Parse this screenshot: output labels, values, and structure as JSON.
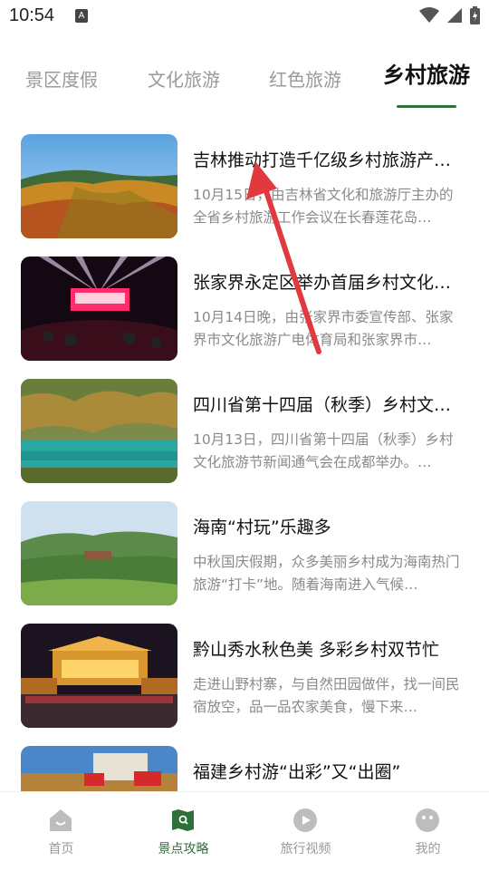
{
  "status": {
    "time": "10:54",
    "notification_badge": "A"
  },
  "tabs": [
    {
      "label": "景区度假",
      "active": false
    },
    {
      "label": "文化旅游",
      "active": false
    },
    {
      "label": "红色旅游",
      "active": false
    },
    {
      "label": "乡村旅游",
      "active": true
    }
  ],
  "articles": [
    {
      "title": "吉林推动打造千亿级乡村旅游产…",
      "desc": "10月15日，由吉林省文化和旅游厅主办的全省乡村旅游工作会议在长春莲花岛…"
    },
    {
      "title": "张家界永定区举办首届乡村文化…",
      "desc": "10月14日晚，由张家界市委宣传部、张家界市文化旅游广电体育局和张家界市…"
    },
    {
      "title": "四川省第十四届（秋季）乡村文…",
      "desc": "10月13日，四川省第十四届（秋季）乡村文化旅游节新闻通气会在成都举办。…"
    },
    {
      "title": "海南“村玩”乐趣多",
      "desc": "中秋国庆假期，众多美丽乡村成为海南热门旅游“打卡”地。随着海南进入气候…"
    },
    {
      "title": "黔山秀水秋色美 多彩乡村双节忙",
      "desc": "走进山野村寨，与自然田园做伴，找一间民宿放空，品一品农家美食，慢下来…"
    },
    {
      "title": "福建乡村游“出彩”又“出圈”",
      "desc": ""
    }
  ],
  "nav": [
    {
      "label": "首页",
      "icon": "home-icon",
      "active": false
    },
    {
      "label": "景点攻略",
      "icon": "map-guide-icon",
      "active": true
    },
    {
      "label": "旅行视频",
      "icon": "play-video-icon",
      "active": false
    },
    {
      "label": "我的",
      "icon": "profile-icon",
      "active": false
    }
  ],
  "colors": {
    "accent": "#2f6f3a",
    "inactive": "#9a9a9a",
    "annotation_arrow": "#e0393e"
  }
}
